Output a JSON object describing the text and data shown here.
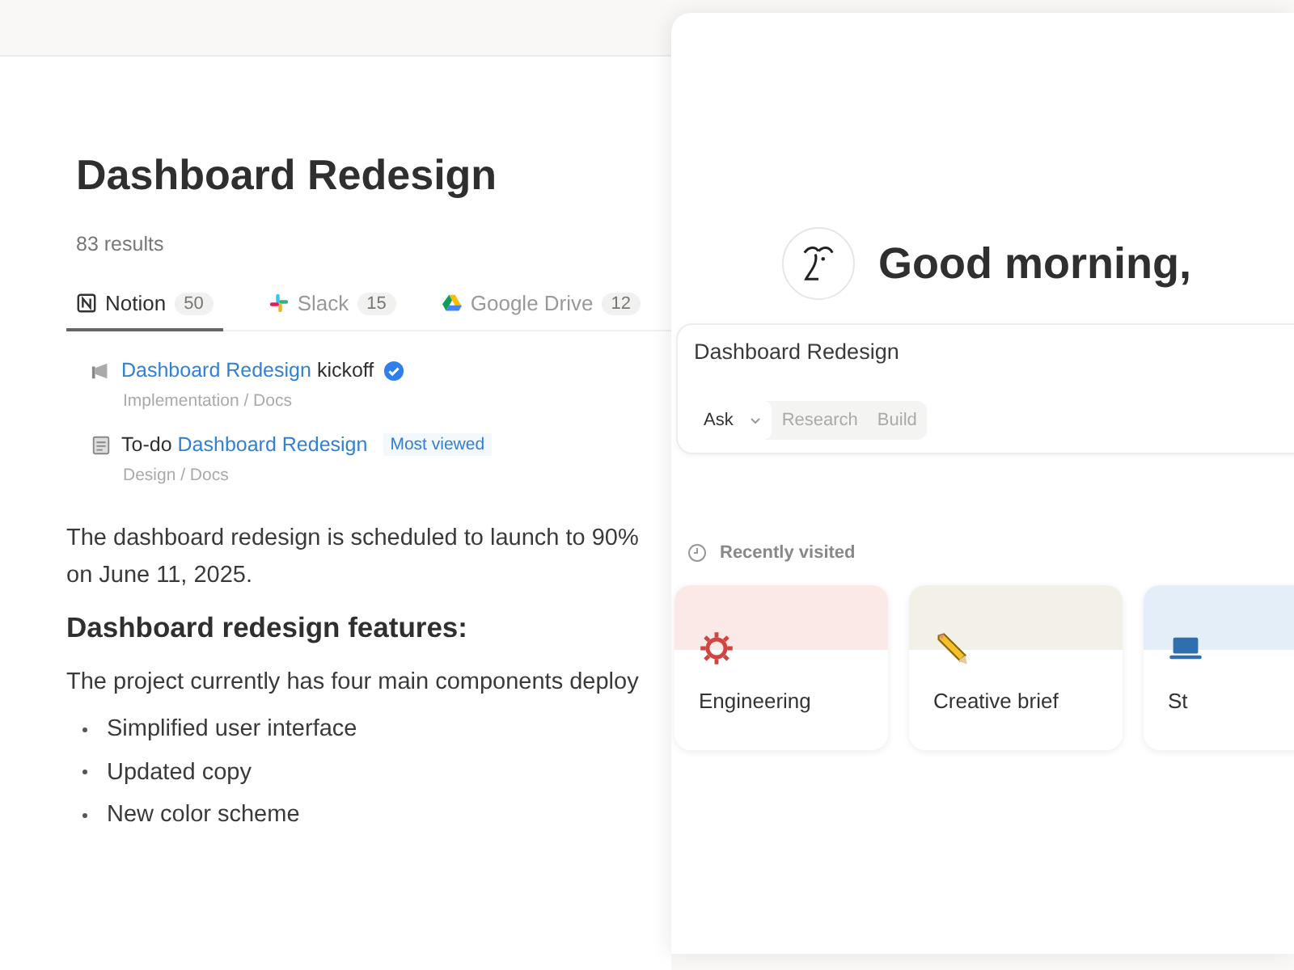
{
  "search": {
    "title": "Dashboard Redesign",
    "result_count": "83 results",
    "tabs": [
      {
        "label": "Notion",
        "count": "50",
        "kind": "notion",
        "selected": true
      },
      {
        "label": "Slack",
        "count": "15",
        "kind": "slack",
        "selected": false
      },
      {
        "label": "Google Drive",
        "count": "12",
        "kind": "drive",
        "selected": false
      }
    ],
    "results": [
      {
        "kind": "announcement",
        "parts": [
          {
            "text": "Dashboard Redesign",
            "match": true
          },
          {
            "text": "kickoff",
            "match": false
          }
        ],
        "verified": true,
        "path": "Implementation / Docs"
      },
      {
        "kind": "page",
        "parts": [
          {
            "text": "To-do",
            "match": false
          },
          {
            "text": "Dashboard Redesign",
            "match": true
          }
        ],
        "verified": false,
        "tag": "Most viewed",
        "path": "Design / Docs"
      }
    ],
    "summary": "The dashboard redesign is scheduled to launch to 90% on June 11, 2025.",
    "heading": "Dashboard redesign features:",
    "intro": "The project currently has four main components deploy",
    "bullets": [
      "Simplified user interface",
      "Updated copy",
      "New color scheme"
    ]
  },
  "home": {
    "greeting": "Good morning,",
    "composer": {
      "value": "Dashboard Redesign",
      "modes": [
        {
          "label": "Ask",
          "selected": true
        },
        {
          "label": "Research",
          "selected": false
        },
        {
          "label": "Build",
          "selected": false
        }
      ]
    },
    "recent_label": "Recently visited",
    "cards": [
      {
        "title": "Engineering",
        "kind": "engineering",
        "color": "#fbe9e7"
      },
      {
        "title": "Creative brief",
        "kind": "writing",
        "color": "#f3f0e8"
      },
      {
        "title": "St",
        "kind": "computer",
        "color": "#e3eef8"
      }
    ]
  }
}
